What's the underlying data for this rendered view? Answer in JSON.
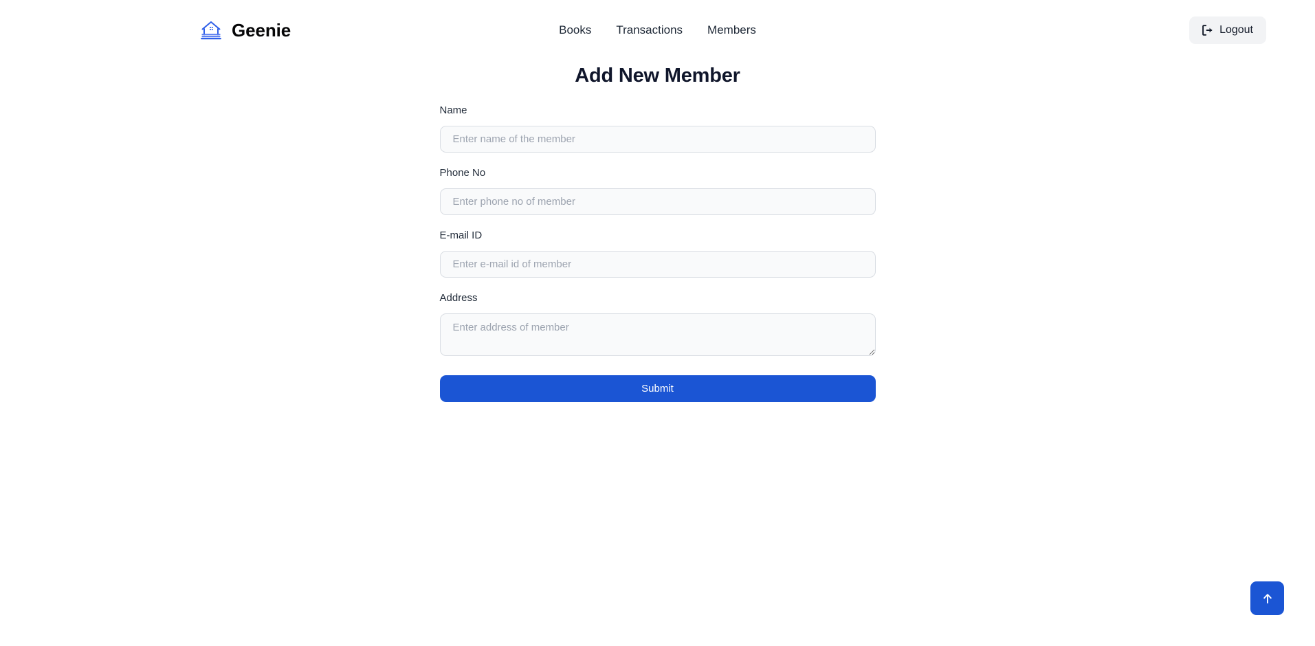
{
  "header": {
    "brand": {
      "name": "Geenie",
      "icon": "library-building-icon",
      "icon_color": "#2f5fe8"
    },
    "nav": [
      {
        "label": "Books",
        "name": "books"
      },
      {
        "label": "Transactions",
        "name": "transactions"
      },
      {
        "label": "Members",
        "name": "members"
      }
    ],
    "logout": {
      "label": "Logout",
      "icon": "sign-out-icon"
    }
  },
  "main": {
    "title": "Add New Member",
    "fields": [
      {
        "label": "Name",
        "placeholder": "Enter name of the member",
        "value": "",
        "name": "name"
      },
      {
        "label": "Phone No",
        "placeholder": "Enter phone no of member",
        "value": "",
        "name": "phone-no"
      },
      {
        "label": "E-mail ID",
        "placeholder": "Enter e-mail id of member",
        "value": "",
        "name": "email-id"
      },
      {
        "label": "Address",
        "placeholder": "Enter address of member",
        "value": "",
        "name": "address"
      }
    ],
    "submit_label": "Submit"
  },
  "scroll_top": {
    "icon": "arrow-up-icon",
    "label": ""
  },
  "colors": {
    "accent": "#1b55d4",
    "brand_icon": "#2f5fe8",
    "input_bg": "#f9fafb",
    "input_border": "#d9dde3",
    "logout_bg": "#f2f3f5",
    "title": "#10162b",
    "placeholder": "#9ca3af"
  }
}
